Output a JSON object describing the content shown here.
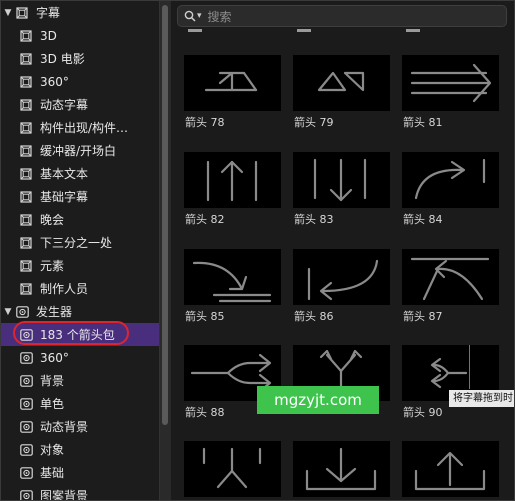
{
  "sidebar": {
    "categories": [
      {
        "label": "字幕",
        "items": [
          "3D",
          "3D 电影",
          "360°",
          "动态字幕",
          "构件出现/构件…",
          "缓冲器/开场白",
          "基本文本",
          "基础字幕",
          "晚会",
          "下三分之一处",
          "元素",
          "制作人员"
        ]
      },
      {
        "label": "发生器",
        "items": [
          "183 个箭头包",
          "360°",
          "背景",
          "单色",
          "动态背景",
          "对象",
          "基础",
          "图案背景"
        ]
      }
    ],
    "selected_item": "183 个箭头包"
  },
  "search": {
    "placeholder": "搜索"
  },
  "thumbnails": [
    {
      "caption": "箭头 78",
      "icon": "split-arrow-78"
    },
    {
      "caption": "箭头 79",
      "icon": "split-arrow-79"
    },
    {
      "caption": "箭头 81",
      "icon": "triple-line-right-arrow"
    },
    {
      "caption": "箭头 82",
      "icon": "up-arrow-bars"
    },
    {
      "caption": "箭头 83",
      "icon": "down-arrow-bars"
    },
    {
      "caption": "箭头 84",
      "icon": "curved-right-arrow"
    },
    {
      "caption": "箭头 85",
      "icon": "curve-down-right-arrow"
    },
    {
      "caption": "箭头 86",
      "icon": "curve-left-arrow"
    },
    {
      "caption": "箭头 87",
      "icon": "curve-up-left-arrow"
    },
    {
      "caption": "箭头 88",
      "icon": "merge-right-arrow"
    },
    {
      "caption": "",
      "icon": "fork-up-arrow"
    },
    {
      "caption": "箭头 90",
      "icon": "left-fork-arrow"
    },
    {
      "caption": "",
      "icon": "fork-down-arrow"
    },
    {
      "caption": "",
      "icon": "down-into-tray-arrow"
    },
    {
      "caption": "",
      "icon": "up-out-of-tray-arrow"
    }
  ],
  "tooltip": {
    "text": "将字幕拖到时"
  },
  "watermark": {
    "text": "mgzyjt.com"
  },
  "colors": {
    "selected_bg": "#4a2e7e",
    "highlight_ring": "#e0242c",
    "watermark_bg": "#3ec44d",
    "arrow_stroke": "#8a8a8a"
  }
}
